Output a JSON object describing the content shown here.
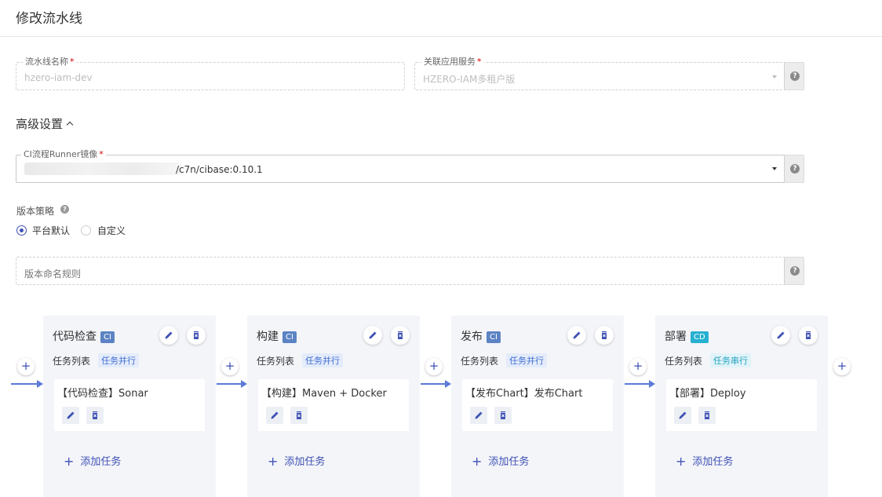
{
  "page": {
    "title": "修改流水线"
  },
  "form": {
    "pipeline_name": {
      "label": "流水线名称",
      "required_mark": "*",
      "value": "hzero-iam-dev"
    },
    "app_service": {
      "label": "关联应用服务",
      "required_mark": "*",
      "value": "HZERO-IAM多租户版"
    },
    "help_glyph": "?"
  },
  "advanced": {
    "title": "高级设置",
    "runner_image": {
      "label": "CI流程Runner镜像",
      "required_mark": "*",
      "value": "/c7n/cibase:0.10.1"
    },
    "version_strategy": {
      "label": "版本策略",
      "options": [
        {
          "label": "平台默认",
          "selected": true
        },
        {
          "label": "自定义",
          "selected": false
        }
      ]
    },
    "version_naming": {
      "placeholder": "版本命名规则"
    }
  },
  "pipeline": {
    "task_list_label": "任务列表",
    "add_task_label": "添加任务",
    "add_glyph": "+",
    "stages": [
      {
        "name": "代码检查",
        "type": "CI",
        "mode": "任务并行",
        "tasks": [
          "【代码检查】Sonar"
        ]
      },
      {
        "name": "构建",
        "type": "CI",
        "mode": "任务并行",
        "tasks": [
          "【构建】Maven + Docker"
        ]
      },
      {
        "name": "发布",
        "type": "CI",
        "mode": "任务并行",
        "tasks": [
          "【发布Chart】发布Chart"
        ]
      },
      {
        "name": "部署",
        "type": "CD",
        "mode": "任务串行",
        "tasks": [
          "【部署】Deploy"
        ]
      }
    ]
  },
  "colors": {
    "primary": "#3f51b5",
    "ci_tag": "#5c83c4",
    "cd_tag": "#27b0d0",
    "required": "#d50000"
  }
}
